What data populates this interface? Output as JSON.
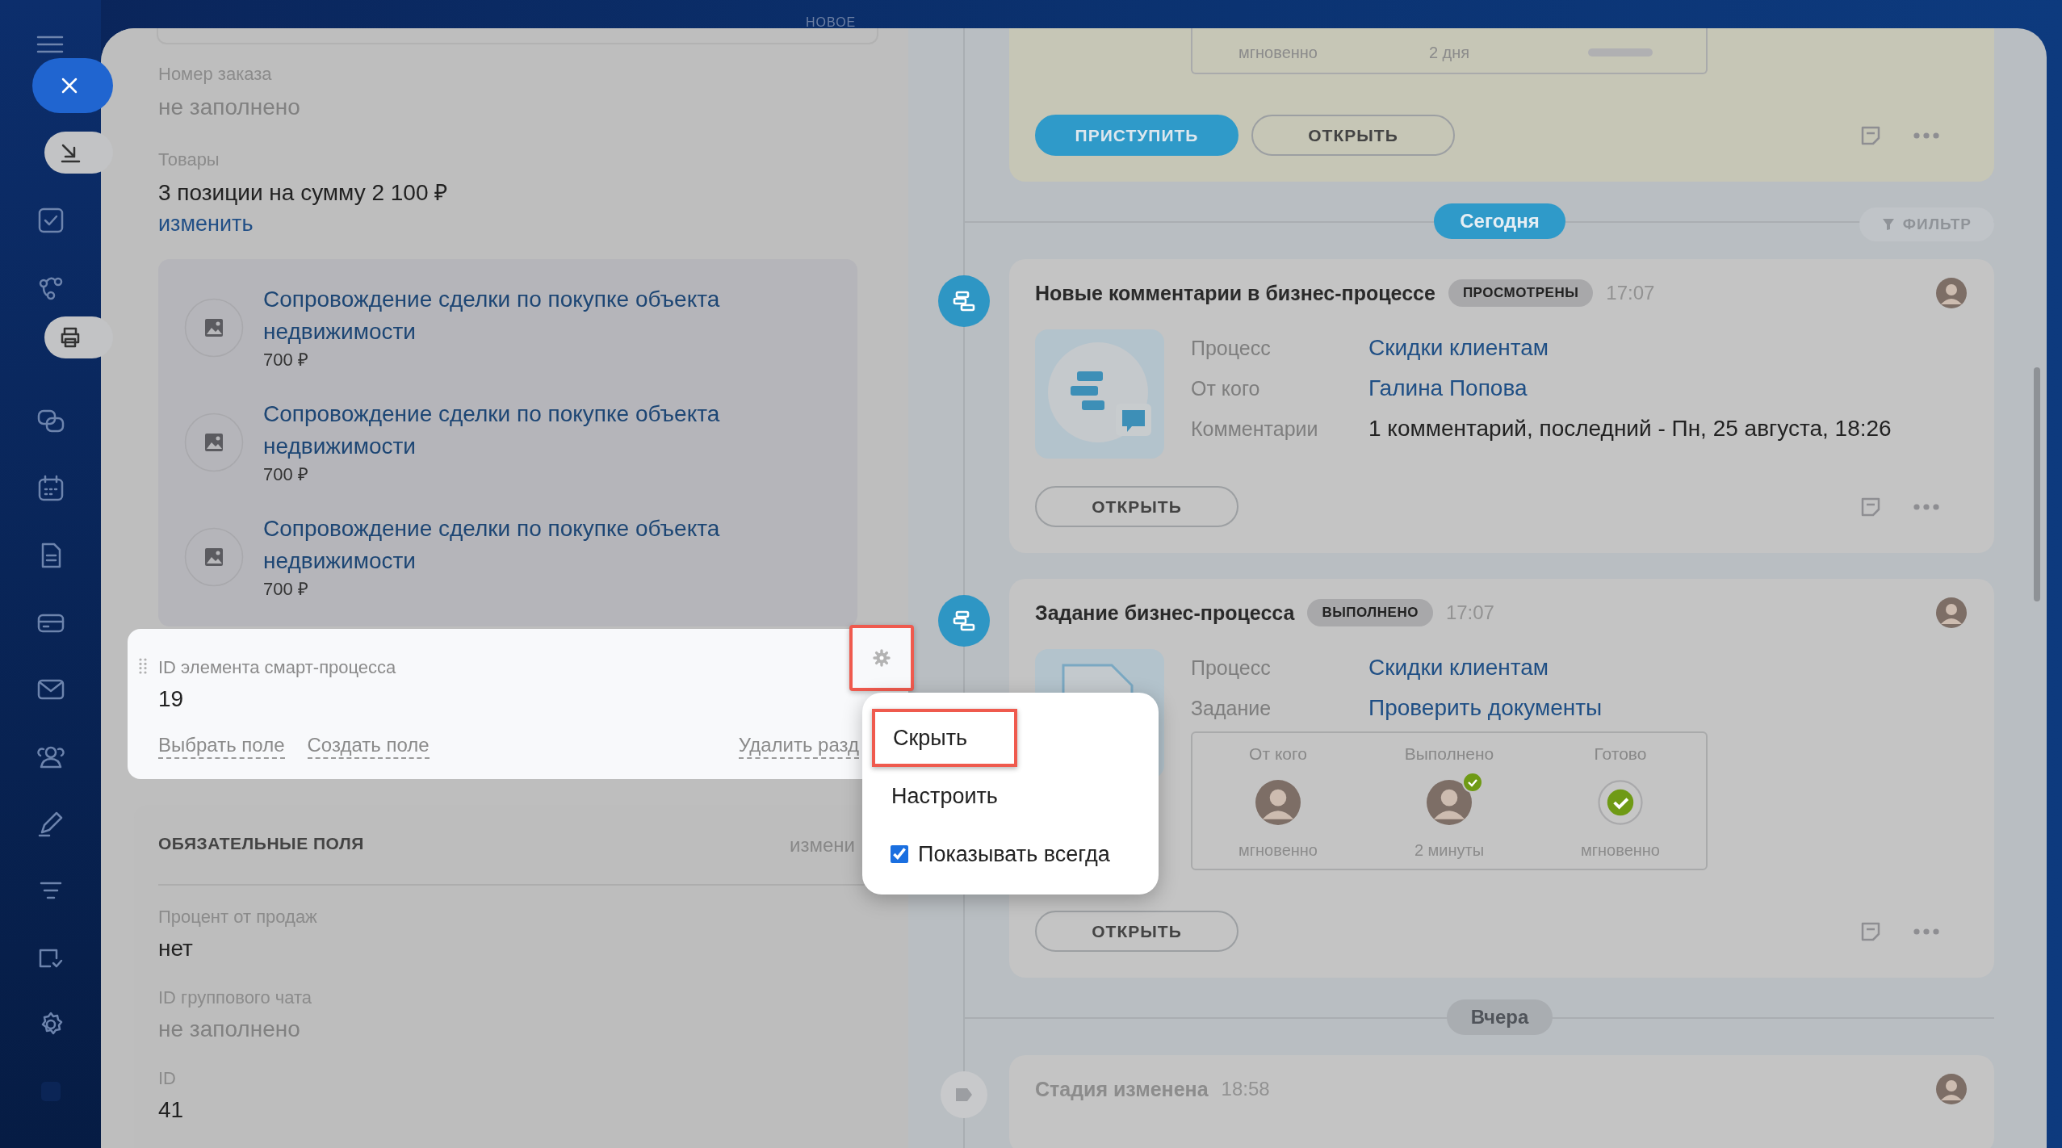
{
  "header_badge": "НОВОЕ",
  "details": {
    "fields": [
      {
        "label": "Номер заказа",
        "value": "не заполнено",
        "empty": true
      },
      {
        "label": "Товары",
        "value": "3 позиции на сумму 2 100 ₽",
        "empty": false,
        "link": "изменить"
      }
    ],
    "products": [
      {
        "title": "Сопровождение сделки по покупке объекта недвижимости",
        "price": "700 ₽"
      },
      {
        "title": "Сопровождение сделки по покупке объекта недвижимости",
        "price": "700 ₽"
      },
      {
        "title": "Сопровождение сделки по покупке объекта недвижимости",
        "price": "700 ₽"
      }
    ],
    "section": {
      "label": "ID элемента смарт-процесса",
      "value": "19",
      "links": [
        "Выбрать поле",
        "Создать поле"
      ],
      "delete": "Удалить разд"
    },
    "required": {
      "title": "ОБЯЗАТЕЛЬНЫЕ ПОЛЯ",
      "action": "измени",
      "fields": [
        {
          "label": "Процент от продаж",
          "value": "нет",
          "empty": false
        },
        {
          "label": "ID группового чата",
          "value": "не заполнено",
          "empty": true
        },
        {
          "label": "ID",
          "value": "41",
          "empty": false
        }
      ]
    }
  },
  "menu": {
    "items": [
      {
        "kind": "action",
        "label": "Скрыть",
        "highlighted": true
      },
      {
        "kind": "action",
        "label": "Настроить",
        "highlighted": false
      },
      {
        "kind": "checkbox",
        "label": "Показывать всегда",
        "checked": true
      }
    ]
  },
  "timeline": {
    "top_card": {
      "steps": [
        {
          "kind": "caption",
          "caption": "мгновенно"
        },
        {
          "kind": "caption",
          "caption": "2 дня"
        },
        {
          "kind": "pending"
        }
      ],
      "buttons": [
        {
          "kind": "primary",
          "label": "ПРИСТУПИТЬ"
        },
        {
          "kind": "secondary",
          "label": "ОТКРЫТЬ"
        }
      ]
    },
    "filter": "ФИЛЬТР",
    "groups": [
      {
        "date": "Сегодня",
        "highlighted": true,
        "cards": [
          {
            "kind": "comments",
            "title": "Новые комментарии в бизнес-процессе",
            "status": "ПРОСМОТРЕНЫ",
            "time": "17:07",
            "rows": [
              {
                "label": "Процесс",
                "value": "Скидки клиентам",
                "link": true
              },
              {
                "label": "От кого",
                "value": "Галина Попова",
                "link": true
              },
              {
                "label": "Комментарии",
                "value": "1 комментарий, последний - Пн, 25 августа, 18:26",
                "link": false
              }
            ],
            "button": "ОТКРЫТЬ"
          },
          {
            "kind": "task",
            "title": "Задание бизнес-процесса",
            "status": "ВЫПОЛНЕНО",
            "time": "17:07",
            "rows": [
              {
                "label": "Процесс",
                "value": "Скидки клиентам",
                "link": true
              },
              {
                "label": "Задание",
                "value": "Проверить документы",
                "link": true
              }
            ],
            "steps": [
              {
                "kind": "person",
                "label": "От кого",
                "caption": "мгновенно"
              },
              {
                "kind": "person_done",
                "label": "Выполнено",
                "caption": "2 минуты"
              },
              {
                "kind": "check",
                "label": "Готово",
                "caption": "мгновенно"
              }
            ],
            "button": "ОТКРЫТЬ"
          }
        ]
      },
      {
        "date": "Вчера",
        "highlighted": false,
        "cards": [
          {
            "kind": "stage",
            "title": "Стадия изменена",
            "time": "18:58"
          }
        ]
      }
    ]
  }
}
